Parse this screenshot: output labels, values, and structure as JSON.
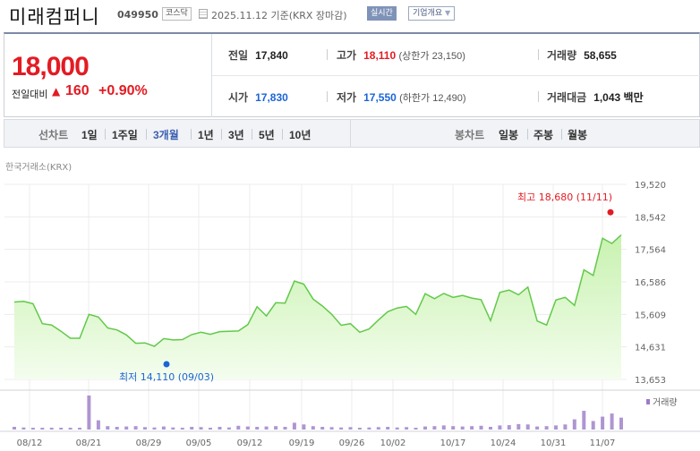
{
  "header": {
    "company": "미래컴퍼니",
    "code": "049950",
    "market": "코스닥",
    "as_of": "2025.11.12  기준(KRX 장마감)",
    "live_label": "실시간",
    "overview_label": "기업개요",
    "overview_caret": "▼"
  },
  "quote": {
    "price": "18,000",
    "change_label": "전일대비",
    "change_arrow": "▲",
    "change_value": "160",
    "change_pct": "+0.90%",
    "prev_label": "전일",
    "prev": "17,840",
    "high_label": "고가",
    "high": "18,110",
    "upper_limit_text": "(상한가 23,150)",
    "volume_label": "거래량",
    "volume": "58,655",
    "open_label": "시가",
    "open": "17,830",
    "low_label": "저가",
    "low": "17,550",
    "lower_limit_text": "(하한가 12,490)",
    "amount_label": "거래대금",
    "amount": "1,043",
    "amount_unit": "백만"
  },
  "tabs": {
    "line_head": "선차트",
    "line": [
      "1일",
      "1주일",
      "3개월",
      "1년",
      "3년",
      "5년",
      "10년"
    ],
    "active": "3개월",
    "candle_head": "봉차트",
    "candle": [
      "일봉",
      "주봉",
      "월봉"
    ]
  },
  "exchange": "한국거래소(KRX)",
  "colors": {
    "up": "#e31b23",
    "down": "#1b64d6",
    "area": "#c8f2b0",
    "line": "#62c94a",
    "volume": "#9b7cc7"
  },
  "chart_data": {
    "type": "area",
    "y_ticks": [
      "19,520",
      "18,542",
      "17,564",
      "16,586",
      "15,609",
      "14,631",
      "13,653"
    ],
    "ylim": [
      13653,
      19520
    ],
    "x_labels": [
      "08/12",
      "08/21",
      "08/29",
      "09/05",
      "09/12",
      "09/19",
      "09/26",
      "10/02",
      "10/17",
      "10/24",
      "10/31",
      "11/07"
    ],
    "series": [
      {
        "values": [
          15980,
          16000,
          15930,
          15330,
          15290,
          15100,
          14890,
          14890,
          15610,
          15530,
          15200,
          15140,
          14990,
          14740,
          14750,
          14650,
          14880,
          14840,
          14850,
          15000,
          15070,
          15010,
          15090,
          15100,
          15110,
          15300,
          15840,
          15560,
          15960,
          15950,
          16610,
          16520,
          16070,
          15860,
          15610,
          15280,
          15330,
          15070,
          15170,
          15440,
          15690,
          15800,
          15850,
          15610,
          16230,
          16080,
          16240,
          16120,
          16180,
          16100,
          16050,
          15420,
          16270,
          16340,
          16200,
          16430,
          15410,
          15290,
          16040,
          16120,
          15880,
          16950,
          16780,
          17900,
          17740,
          18000
        ]
      }
    ],
    "max_label": "최고 18,680 (11/11)",
    "min_label": "최저 14,110 (09/03)",
    "volume_legend": "거래량",
    "volume": [
      0.08,
      0.06,
      0.05,
      0.05,
      0.04,
      0.05,
      0.04,
      0.05,
      1.0,
      0.27,
      0.1,
      0.08,
      0.09,
      0.1,
      0.07,
      0.06,
      0.09,
      0.06,
      0.05,
      0.08,
      0.07,
      0.05,
      0.08,
      0.06,
      0.11,
      0.09,
      0.08,
      0.09,
      0.1,
      0.08,
      0.2,
      0.15,
      0.1,
      0.08,
      0.07,
      0.06,
      0.07,
      0.05,
      0.06,
      0.07,
      0.08,
      0.06,
      0.07,
      0.05,
      0.09,
      0.1,
      0.12,
      0.1,
      0.09,
      0.1,
      0.11,
      0.08,
      0.12,
      0.13,
      0.16,
      0.15,
      0.09,
      0.1,
      0.12,
      0.15,
      0.3,
      0.55,
      0.25,
      0.38,
      0.47,
      0.35
    ]
  }
}
